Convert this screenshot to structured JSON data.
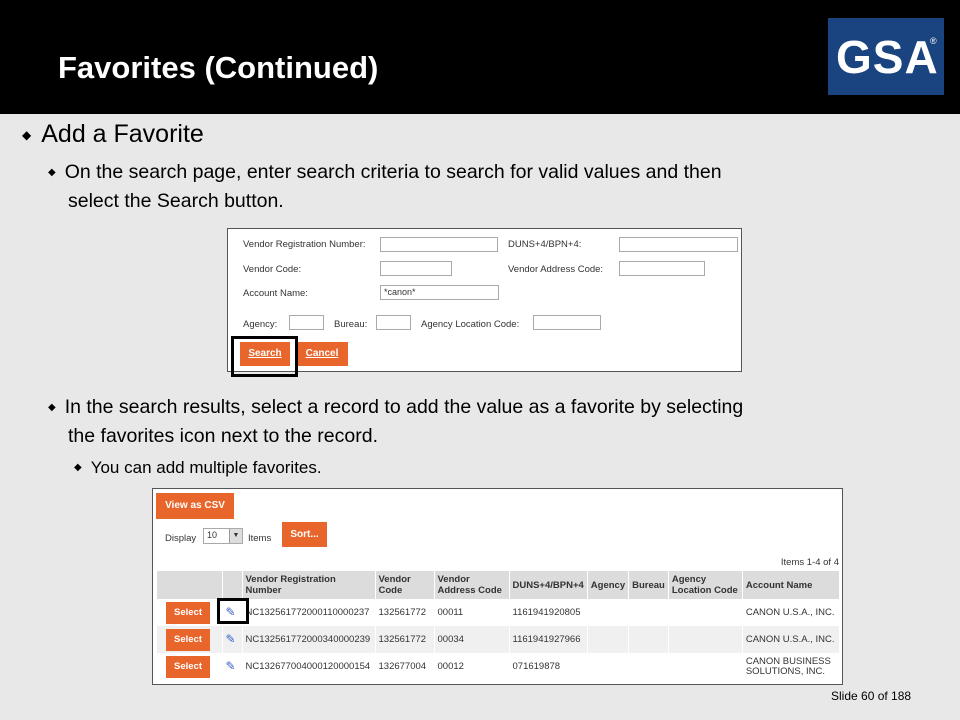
{
  "slide": {
    "title": "Favorites (Continued)",
    "logo_text": "GSA",
    "logo_mark": "®",
    "bullet1": "Add a Favorite",
    "bullet2_line1": "On the search page, enter search criteria to search for valid values and then",
    "bullet2_line2": "select the Search button.",
    "bullet3_line1": "In the search results, select a record to add the value as a favorite by selecting",
    "bullet3_line2": "the favorites icon next to the record.",
    "bullet4": "You can add multiple favorites.",
    "slide_number": "Slide 60 of 188",
    "colors": {
      "header": "#000000",
      "logo_bg": "#1a4480",
      "button": "#e8652c"
    }
  },
  "search_form": {
    "vendor_reg_label": "Vendor Registration Number:",
    "duns_label": "DUNS+4/BPN+4:",
    "vendor_code_label": "Vendor Code:",
    "vendor_address_label": "Vendor Address Code:",
    "account_name_label": "Account Name:",
    "account_name_value": "*canon*",
    "agency_label": "Agency:",
    "bureau_label": "Bureau:",
    "agency_location_label": "Agency Location Code:",
    "search_button": "Search",
    "cancel_button": "Cancel"
  },
  "results": {
    "csv_button": "View as CSV",
    "display_label": "Display",
    "display_value": "10",
    "items_label": "Items",
    "sort_button": "Sort...",
    "items_count": "Items 1-4 of 4",
    "select_label": "Select",
    "columns": [
      "Vendor Registration Number",
      "Vendor Code",
      "Vendor Address Code",
      "DUNS+4/BPN+4",
      "Agency",
      "Bureau",
      "Agency Location Code",
      "Account Name"
    ],
    "rows": [
      [
        "NC132561772000110000237",
        "132561772",
        "00011",
        "1161941920805",
        "",
        "",
        "",
        "CANON U.S.A., INC."
      ],
      [
        "NC132561772000340000239",
        "132561772",
        "00034",
        "1161941927966",
        "",
        "",
        "",
        "CANON U.S.A., INC."
      ],
      [
        "NC132677004000120000154",
        "132677004",
        "00012",
        "071619878",
        "",
        "",
        "",
        "CANON BUSINESS SOLUTIONS, INC."
      ]
    ]
  }
}
